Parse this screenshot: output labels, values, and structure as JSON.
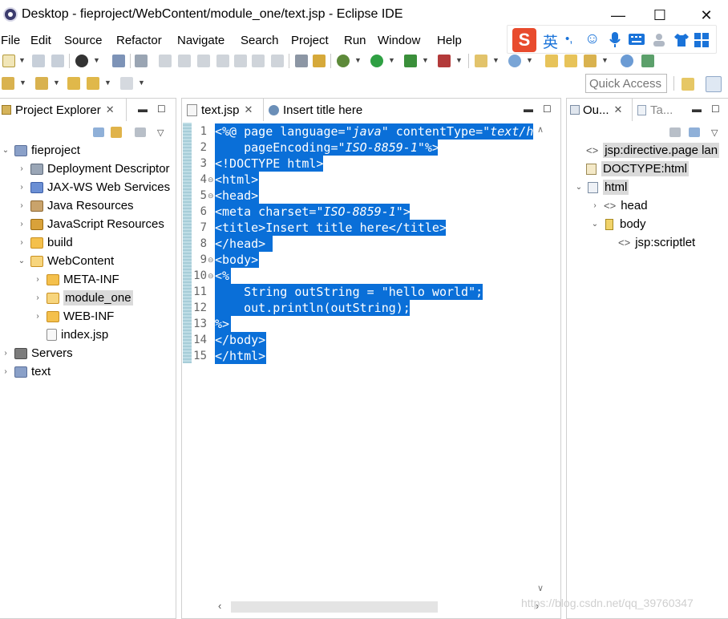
{
  "window": {
    "title": "Desktop - fieproject/WebContent/module_one/text.jsp - Eclipse IDE",
    "minimize": "—",
    "maximize": "☐",
    "close": "✕"
  },
  "menu": [
    "File",
    "Edit",
    "Source",
    "Refactor",
    "Navigate",
    "Search",
    "Project",
    "Run",
    "Window",
    "Help"
  ],
  "ime": {
    "logo": "S",
    "mode": "英",
    "punct": "•,",
    "emoji": "☺"
  },
  "quick_access": "Quick Access",
  "explorer": {
    "tab_label": "Project Explorer",
    "tree": [
      {
        "label": "fieproject",
        "level": 0,
        "state": "expanded",
        "icon": "project-icon"
      },
      {
        "label": "Deployment Descriptor",
        "level": 1,
        "state": "collapsed",
        "icon": "deployment-descriptor-icon"
      },
      {
        "label": "JAX-WS Web Services",
        "level": 1,
        "state": "collapsed",
        "icon": "web-services-icon"
      },
      {
        "label": "Java Resources",
        "level": 1,
        "state": "collapsed",
        "icon": "java-resources-icon"
      },
      {
        "label": "JavaScript Resources",
        "level": 1,
        "state": "collapsed",
        "icon": "javascript-resources-icon"
      },
      {
        "label": "build",
        "level": 1,
        "state": "collapsed",
        "icon": "folder-icon"
      },
      {
        "label": "WebContent",
        "level": 1,
        "state": "expanded",
        "icon": "folder-open-icon"
      },
      {
        "label": "META-INF",
        "level": 2,
        "state": "collapsed",
        "icon": "folder-icon"
      },
      {
        "label": "module_one",
        "level": 2,
        "state": "collapsed",
        "icon": "folder-open-icon",
        "selected": true
      },
      {
        "label": "WEB-INF",
        "level": 2,
        "state": "collapsed",
        "icon": "folder-icon"
      },
      {
        "label": "index.jsp",
        "level": 2,
        "state": "leaf",
        "icon": "jsp-file-icon"
      },
      {
        "label": "Servers",
        "level": 0,
        "state": "collapsed",
        "icon": "servers-icon"
      },
      {
        "label": "text",
        "level": 0,
        "state": "collapsed",
        "icon": "project-icon"
      }
    ]
  },
  "editor": {
    "tabs": [
      {
        "label": "text.jsp",
        "active": true
      },
      {
        "label": "Insert title here",
        "active": false
      }
    ],
    "lines": [
      {
        "n": "1",
        "fold": "",
        "segments": [
          [
            "<%@ page language=",
            ""
          ],
          [
            "\"java\"",
            "italic"
          ],
          [
            " contentType=",
            ""
          ],
          [
            "\"text/h",
            "italic"
          ]
        ]
      },
      {
        "n": "2",
        "fold": "",
        "segments": [
          [
            "    pageEncoding=",
            ""
          ],
          [
            "\"ISO-8859-1\"",
            "italic"
          ],
          [
            "%>",
            ""
          ]
        ]
      },
      {
        "n": "3",
        "fold": "",
        "segments": [
          [
            "<!DOCTYPE html>",
            ""
          ]
        ]
      },
      {
        "n": "4",
        "fold": "⊖",
        "segments": [
          [
            "<html>",
            ""
          ]
        ]
      },
      {
        "n": "5",
        "fold": "⊖",
        "segments": [
          [
            "<head>",
            ""
          ]
        ]
      },
      {
        "n": "6",
        "fold": "",
        "segments": [
          [
            "<meta charset=",
            ""
          ],
          [
            "\"ISO-8859-1\"",
            "italic"
          ],
          [
            ">",
            ""
          ]
        ]
      },
      {
        "n": "7",
        "fold": "",
        "segments": [
          [
            "<title>Insert title here</title>",
            ""
          ]
        ]
      },
      {
        "n": "8",
        "fold": "",
        "segments": [
          [
            "</head>",
            ""
          ]
        ]
      },
      {
        "n": "9",
        "fold": "⊖",
        "segments": [
          [
            "<body>",
            ""
          ]
        ]
      },
      {
        "n": "10",
        "fold": "⊖",
        "segments": [
          [
            "<%",
            ""
          ]
        ]
      },
      {
        "n": "11",
        "fold": "",
        "segments": [
          [
            "    String outString = \"hello world\";",
            ""
          ]
        ]
      },
      {
        "n": "12",
        "fold": "",
        "segments": [
          [
            "    out.println(outString);",
            ""
          ]
        ]
      },
      {
        "n": "13",
        "fold": "",
        "segments": [
          [
            "%>",
            ""
          ]
        ]
      },
      {
        "n": "14",
        "fold": "",
        "segments": [
          [
            "</body>",
            ""
          ]
        ]
      },
      {
        "n": "15",
        "fold": "",
        "segments": [
          [
            "</html>",
            ""
          ]
        ]
      }
    ],
    "selection_color": "#0a6fd8"
  },
  "outline": {
    "tabs": [
      {
        "label": "Ou...",
        "active": true
      },
      {
        "label": "Ta...",
        "active": false
      }
    ],
    "tree": [
      {
        "label": "jsp:directive.page lan",
        "level": 0,
        "state": "leaf",
        "icon": "directive-icon",
        "highlight": true
      },
      {
        "label": "DOCTYPE:html",
        "level": 0,
        "state": "leaf",
        "icon": "doctype-icon",
        "highlight": true
      },
      {
        "label": "html",
        "level": 0,
        "state": "expanded",
        "icon": "html-element-icon",
        "highlight": true
      },
      {
        "label": "head",
        "level": 1,
        "state": "collapsed",
        "icon": "element-icon"
      },
      {
        "label": "body",
        "level": 1,
        "state": "expanded",
        "icon": "body-element-icon"
      },
      {
        "label": "jsp:scriptlet",
        "level": 2,
        "state": "leaf",
        "icon": "scriptlet-icon"
      }
    ]
  },
  "watermark": "https://blog.csdn.net/qq_39760347"
}
